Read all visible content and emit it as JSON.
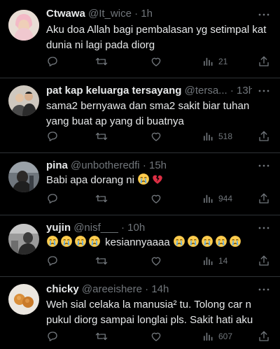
{
  "tweets": [
    {
      "name": "Ctwawa",
      "handle": "@It_wice",
      "dot": "·",
      "time": "1h",
      "text": "Aku doa Allah bagi pembalasan yg setimpal kat dunia ni lagi pada diorg",
      "views": "21",
      "avatar_bg": "#e8d9cf"
    },
    {
      "name": "pat kap keluarga tersayang",
      "handle": "@tersa...",
      "dot": "·",
      "time": "13h",
      "text": "sama2 bernyawa dan sma2 sakit biar tuhan yang buat ap yang di buatnya",
      "views": "518",
      "avatar_bg": "#c9c3bb"
    },
    {
      "name": "pina",
      "handle": "@unbotheredfi",
      "dot": "·",
      "time": "15h",
      "text": "Babi apa dorang ni",
      "views": "944",
      "avatar_bg": "#5a6068"
    },
    {
      "name": "yujin",
      "handle": "@nisf___",
      "dot": "·",
      "time": "10h",
      "text": "kesiannyaaaa",
      "views": "14",
      "avatar_bg": "#8b8b8b"
    },
    {
      "name": "chicky",
      "handle": "@areeishere",
      "dot": "·",
      "time": "14h",
      "text": "Weh sial celaka la manusia² tu. Tolong car n pukul diorg sampai longlai pls. Sakit hati aku",
      "views": "607",
      "avatar_bg": "#e9e6e0"
    }
  ],
  "colors": {
    "background": "#000000",
    "text": "#e7e9ea",
    "muted": "#71767b",
    "divider": "#2f3336"
  }
}
